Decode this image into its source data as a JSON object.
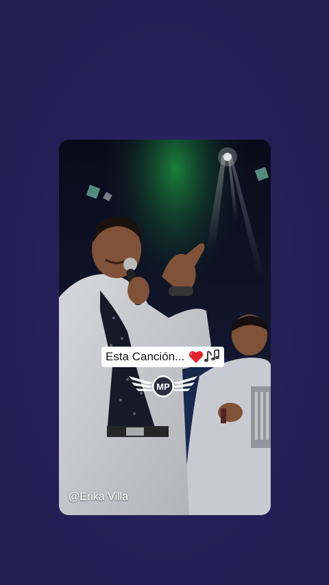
{
  "theme": {
    "background": "#27215a",
    "caption_background": "#ffffff",
    "heart_color": "#e0242b"
  },
  "video": {
    "caption": "Esta Canción...",
    "caption_icons": [
      "heart-icon",
      "music-notes-icon"
    ],
    "logo_text": "MP",
    "watermark": "@Erika Villa"
  }
}
